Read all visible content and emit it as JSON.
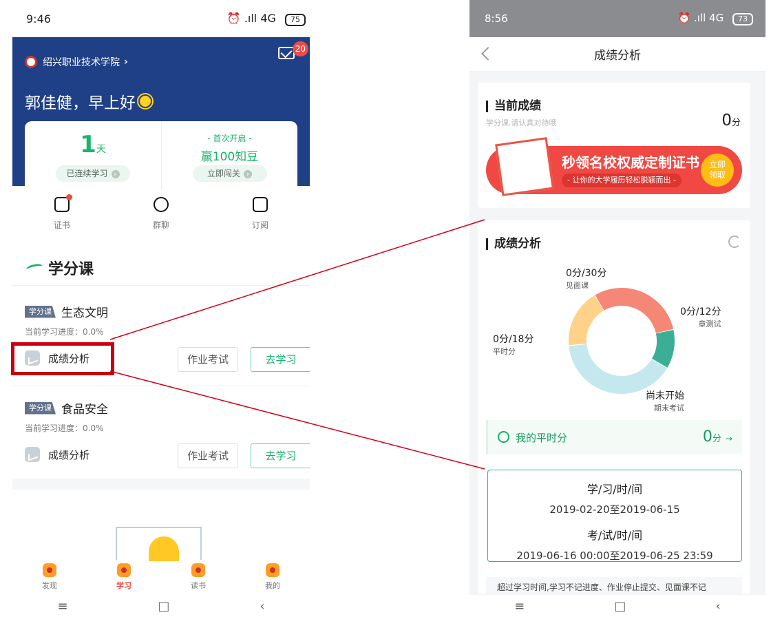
{
  "left_phone": {
    "status": {
      "time": "9:46",
      "indicators": "⏰ .ıll 4G",
      "battery": "75"
    },
    "header": {
      "school": "绍兴职业技术学院",
      "school_chevron": "›",
      "mail_icon": "mail-icon",
      "mail_badge": "20",
      "greeting": "郭佳健，早上好",
      "greeting_icon": "sun-icon"
    },
    "stats": {
      "days_value": "1",
      "days_unit": "天",
      "days_button": "已连续学习",
      "first_open": "- 首次开启 -",
      "reward": "赢100知豆",
      "challenge_button": "立即闯关"
    },
    "quick_links": [
      {
        "label": "证书",
        "icon": "certificate-icon",
        "has_dot": true
      },
      {
        "label": "群聊",
        "icon": "chat-icon",
        "has_dot": false
      },
      {
        "label": "订阅",
        "icon": "subscribe-icon",
        "has_dot": false
      }
    ],
    "section_title": "学分课",
    "courses": [
      {
        "tag": "学分课",
        "name": "生态文明",
        "progress": "当前学习进度：0.0%",
        "analysis": "成绩分析",
        "homework_button": "作业考试",
        "study_button": "去学习"
      },
      {
        "tag": "学分课",
        "name": "食品安全",
        "progress": "当前学习进度：0.0%",
        "analysis": "成绩分析",
        "homework_button": "作业考试",
        "study_button": "去学习"
      }
    ],
    "bottom_nav": [
      {
        "label": "发现",
        "icon": "discover-icon",
        "active": false
      },
      {
        "label": "学习",
        "icon": "study-icon",
        "active": true
      },
      {
        "label": "读书",
        "icon": "read-icon",
        "active": false
      },
      {
        "label": "我的",
        "icon": "profile-icon",
        "active": false
      }
    ],
    "system_nav": [
      "≡",
      "□",
      "‹"
    ]
  },
  "right_phone": {
    "status": {
      "time": "8:56",
      "indicators": "⏰ .ıll 4G",
      "battery": "73"
    },
    "title": "成绩分析",
    "back_icon": "back-chevron-icon",
    "current_score": {
      "title": "当前成绩",
      "subtitle": "学分课,请认真对待哦",
      "value": "0",
      "unit": "分"
    },
    "banner": {
      "main": "秒领名校权威定制证书",
      "sub": "- 让你的大学履历轻松脱颖而出 -",
      "claim": "立即领取"
    },
    "analysis": {
      "title": "成绩分析",
      "refresh_icon": "refresh-icon",
      "chart_data": {
        "type": "pie",
        "series": [
          {
            "name": "见面课",
            "score": "0分/30分",
            "value": 30,
            "color": "#f48776"
          },
          {
            "name": "章测试",
            "score": "0分/12分",
            "value": 12,
            "color": "#3cae96"
          },
          {
            "name": "期末考试",
            "score": "尚未开始",
            "value": 40,
            "color": "#c5e8ef"
          },
          {
            "name": "平时分",
            "score": "0分/18分",
            "value": 18,
            "color": "#ffd28b"
          }
        ]
      },
      "my_score": {
        "label": "我的平时分",
        "value": "0",
        "unit": "分"
      },
      "study_time_label": "学/习/时/间",
      "study_time_value": "2019-02-20至2019-06-15",
      "exam_time_label": "考/试/时/间",
      "exam_time_value": "2019-06-16 00:00至2019-06-25 23:59",
      "notice": "超过学习时间,学习不记进度、作业停止提交、见面课不记"
    },
    "system_nav": [
      "≡",
      "□",
      "‹"
    ]
  },
  "annotation": {
    "highlight_color": "#c7000f",
    "line_color": "#d90012"
  }
}
